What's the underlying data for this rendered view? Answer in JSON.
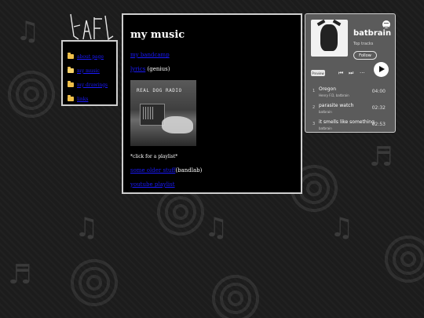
{
  "logo": {
    "text": "batbrain"
  },
  "nav": {
    "items": [
      {
        "label": "about page",
        "icon": "folder-icon"
      },
      {
        "label": "my music",
        "icon": "folder-open-icon"
      },
      {
        "label": "my drawings",
        "icon": "folder-icon"
      },
      {
        "label": "links",
        "icon": "folder-icon"
      }
    ]
  },
  "main": {
    "title": "my music",
    "bandcamp_link": "my bandcamp",
    "lyrics_link": "lyrics",
    "lyrics_suffix": "(genius)",
    "cover_text": "REAL DOG RADIO",
    "playlist_note": "*click for a playlist*",
    "songs_link": "some older stuff",
    "songs_suffix": "(bandlab)",
    "youtube_link": "youtube playlist"
  },
  "spotify": {
    "artist": "batbrain",
    "subtitle": "Top tracks",
    "follow_label": "Follow",
    "preview_label": "Preview",
    "controls": {
      "prev": "⏮",
      "next": "⏭",
      "more": "···"
    },
    "tracks": [
      {
        "num": "1",
        "title": "Oregon",
        "artist": "Henry F.D, batbrain",
        "duration": "04:00"
      },
      {
        "num": "2",
        "title": "parasite watch",
        "artist": "batbrain",
        "duration": "02:32"
      },
      {
        "num": "3",
        "title": "it smells like something...",
        "artist": "batbrain",
        "duration": "02:53"
      }
    ]
  }
}
